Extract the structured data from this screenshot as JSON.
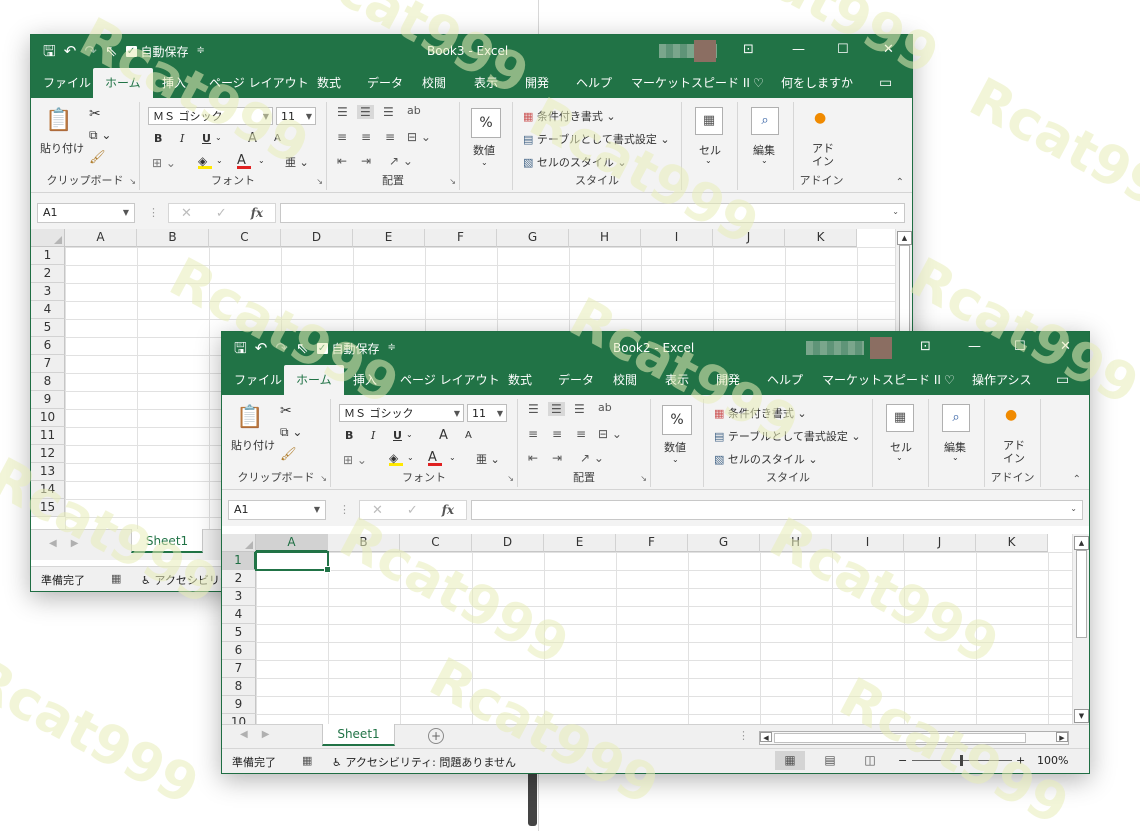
{
  "watermark": "Rcat999",
  "colors": {
    "excel_green": "#217346",
    "ribbon_bg": "#f3f3f3",
    "font_red": "#e02020",
    "highlight_yellow": "#ffe800"
  },
  "windows": [
    {
      "title": "Book3  -  Excel",
      "autosave_label": "自動保存",
      "tabs": [
        "ファイル",
        "ホーム",
        "挿入",
        "ページ レイアウト",
        "数式",
        "データ",
        "校閲",
        "表示",
        "開発",
        "ヘルプ",
        "マーケットスピード II"
      ],
      "active_tab": "ホーム",
      "tell_me": "何をしますか",
      "ribbon": {
        "clipboard": {
          "paste": "貼り付け",
          "label": "クリップボード"
        },
        "font": {
          "name": "ＭＳ ゴシック",
          "size": "11",
          "bold": "B",
          "italic": "I",
          "underline": "U",
          "grow": "A",
          "shrink": "A",
          "font_color": "A",
          "label": "フォント"
        },
        "alignment": {
          "label": "配置"
        },
        "number": {
          "symbol": "%",
          "label": "数値"
        },
        "styles": {
          "conditional": "条件付き書式",
          "table": "テーブルとして書式設定",
          "cell_styles": "セルのスタイル",
          "label": "スタイル"
        },
        "cells": {
          "label": "セル"
        },
        "editing": {
          "label": "編集"
        },
        "addins": {
          "button": "アド\nイン",
          "label": "アドイン"
        }
      },
      "name_box": "A1",
      "columns": [
        "A",
        "B",
        "C",
        "D",
        "E",
        "F",
        "G",
        "H",
        "I",
        "J",
        "K"
      ],
      "rows": [
        "1",
        "2",
        "3",
        "4",
        "5",
        "6",
        "7",
        "8",
        "9",
        "10",
        "11",
        "12",
        "13",
        "14",
        "15"
      ],
      "sheet_tab": "Sheet1",
      "status": {
        "ready": "準備完了",
        "accessibility": "アクセシビリティ"
      }
    },
    {
      "title": "Book2  -  Excel",
      "autosave_label": "自動保存",
      "tabs": [
        "ファイル",
        "ホーム",
        "挿入",
        "ページ レイアウト",
        "数式",
        "データ",
        "校閲",
        "表示",
        "開発",
        "ヘルプ",
        "マーケットスピード II"
      ],
      "active_tab": "ホーム",
      "tell_me": "操作アシス",
      "ribbon": {
        "clipboard": {
          "paste": "貼り付け",
          "label": "クリップボード"
        },
        "font": {
          "name": "ＭＳ ゴシック",
          "size": "11",
          "bold": "B",
          "italic": "I",
          "underline": "U",
          "grow": "A",
          "shrink": "A",
          "font_color": "A",
          "label": "フォント"
        },
        "alignment": {
          "label": "配置"
        },
        "number": {
          "symbol": "%",
          "label": "数値"
        },
        "styles": {
          "conditional": "条件付き書式",
          "table": "テーブルとして書式設定",
          "cell_styles": "セルのスタイル",
          "label": "スタイル"
        },
        "cells": {
          "label": "セル"
        },
        "editing": {
          "label": "編集"
        },
        "addins": {
          "button": "アド\nイン",
          "label": "アドイン"
        }
      },
      "name_box": "A1",
      "columns": [
        "A",
        "B",
        "C",
        "D",
        "E",
        "F",
        "G",
        "H",
        "I",
        "J",
        "K"
      ],
      "rows": [
        "1",
        "2",
        "3",
        "4",
        "5",
        "6",
        "7",
        "8",
        "9",
        "10"
      ],
      "sheet_tab": "Sheet1",
      "status": {
        "ready": "準備完了",
        "accessibility": "アクセシビリティ: 問題ありません",
        "zoom_minus": "−",
        "zoom_plus": "+",
        "zoom": "100%"
      }
    }
  ]
}
